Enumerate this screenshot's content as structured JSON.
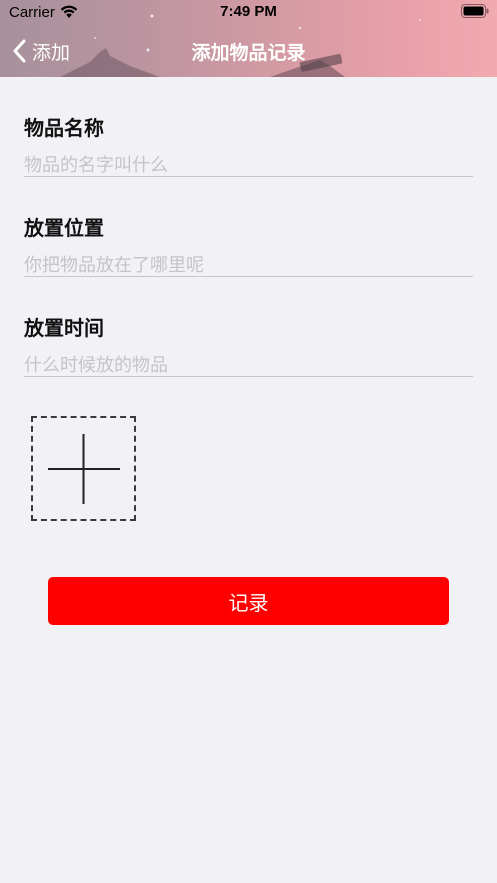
{
  "status_bar": {
    "carrier": "Carrier",
    "time": "7:49 PM"
  },
  "nav": {
    "back_label": "添加",
    "title": "添加物品记录"
  },
  "form": {
    "fields": [
      {
        "label": "物品名称",
        "placeholder": "物品的名字叫什么",
        "value": ""
      },
      {
        "label": "放置位置",
        "placeholder": "你把物品放在了哪里呢",
        "value": ""
      },
      {
        "label": "放置时间",
        "placeholder": "什么时候放的物品",
        "value": ""
      }
    ],
    "add_photo_icon": "plus-icon"
  },
  "submit": {
    "label": "记录",
    "color": "#ff0000"
  },
  "colors": {
    "background": "#f2f1f6",
    "header_gradient_start": "#a7919c",
    "header_gradient_end": "#f1aab0",
    "placeholder": "#c4c4c9",
    "divider": "#c6c5ca"
  }
}
